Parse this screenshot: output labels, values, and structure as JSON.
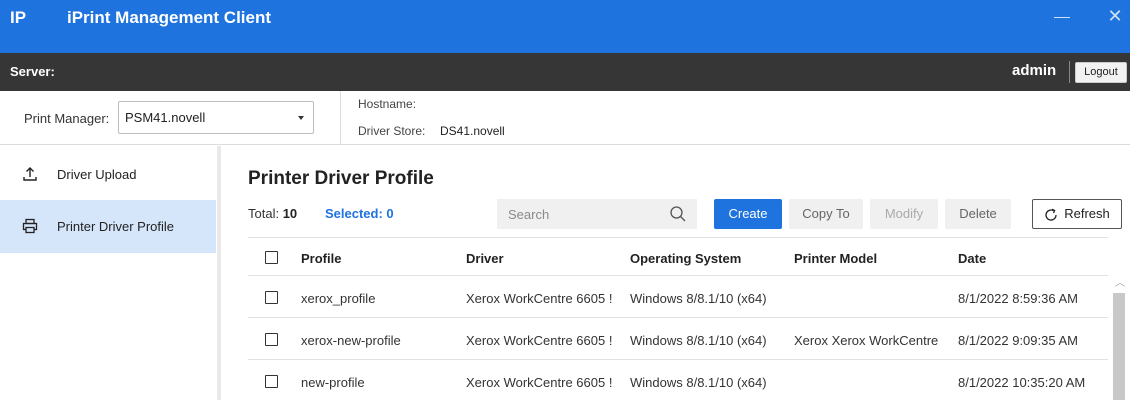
{
  "titlebar": {
    "logo": "IP",
    "title": "iPrint Management Client"
  },
  "serverbar": {
    "server_label": "Server:",
    "user": "admin",
    "logout_label": "Logout"
  },
  "info": {
    "print_manager_label": "Print Manager:",
    "print_manager_value": "PSM41.novell",
    "hostname_label": "Hostname:",
    "driver_store_label": "Driver Store:",
    "driver_store_value": "DS41.novell"
  },
  "sidebar": {
    "items": [
      {
        "label": "Driver Upload",
        "icon": "upload-icon",
        "active": false
      },
      {
        "label": "Printer Driver Profile",
        "icon": "printer-icon",
        "active": true
      }
    ]
  },
  "main": {
    "title": "Printer Driver Profile",
    "total_label": "Total:",
    "total_value": "10",
    "selected_text": "Selected: 0",
    "search_placeholder": "Search",
    "buttons": {
      "create": "Create",
      "copy_to": "Copy To",
      "modify": "Modify",
      "delete": "Delete",
      "refresh": "Refresh"
    }
  },
  "table": {
    "columns": [
      "Profile",
      "Driver",
      "Operating System",
      "Printer Model",
      "Date"
    ],
    "rows": [
      {
        "profile": "xerox_profile",
        "driver": "Xerox WorkCentre 6605 !",
        "os": "Windows 8/8.1/10 (x64)",
        "model": "",
        "date": "8/1/2022 8:59:36 AM"
      },
      {
        "profile": "xerox-new-profile",
        "driver": "Xerox WorkCentre 6605 !",
        "os": "Windows 8/8.1/10 (x64)",
        "model": "Xerox Xerox WorkCentre",
        "date": "8/1/2022 9:09:35 AM"
      },
      {
        "profile": "new-profile",
        "driver": "Xerox WorkCentre 6605 !",
        "os": "Windows 8/8.1/10 (x64)",
        "model": "",
        "date": "8/1/2022 10:35:20 AM"
      }
    ]
  },
  "colors": {
    "accent": "#1e73de",
    "titlebar": "#1e73de",
    "serverbar": "#363636",
    "active_item": "#d6e6fa"
  }
}
